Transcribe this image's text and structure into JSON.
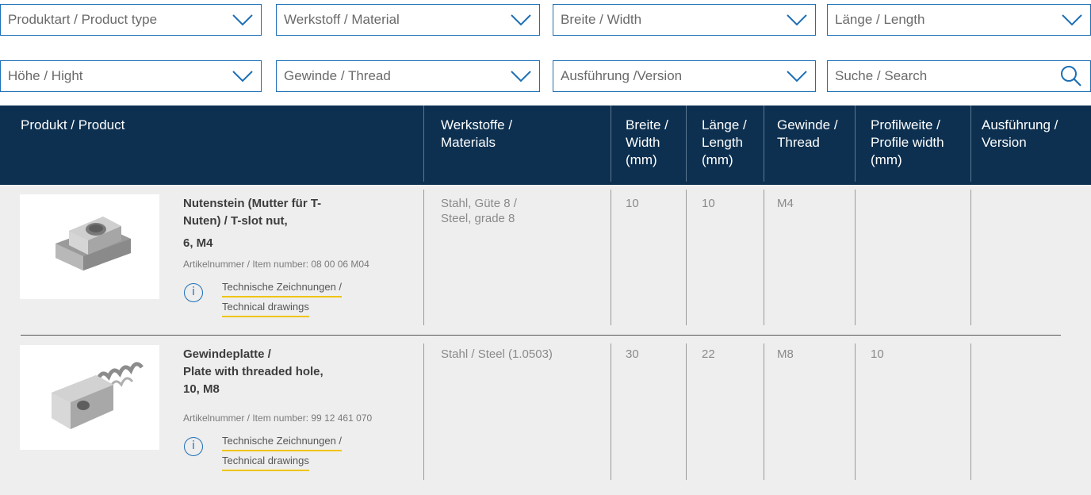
{
  "filters": [
    {
      "label": "Produktart / Product type"
    },
    {
      "label": "Werkstoff / Material"
    },
    {
      "label": "Breite / Width"
    },
    {
      "label": "Länge / Length"
    },
    {
      "label": "Höhe / Hight"
    },
    {
      "label": "Gewinde / Thread"
    },
    {
      "label": "Ausführung /Version"
    }
  ],
  "search": {
    "placeholder": "Suche / Search"
  },
  "columns": [
    {
      "l1": "Produkt / Product",
      "l2": ""
    },
    {
      "l1": "Werkstoffe /",
      "l2": "Materials"
    },
    {
      "l1": "Breite /",
      "l2": "Width",
      "l3": "(mm)"
    },
    {
      "l1": "Länge /",
      "l2": "Length",
      "l3": "(mm)"
    },
    {
      "l1": "Gewinde /",
      "l2": "Thread"
    },
    {
      "l1": "Profilweite /",
      "l2": "Profile width",
      "l3": "(mm)"
    },
    {
      "l1": "Ausführung /",
      "l2": "Version"
    }
  ],
  "rows": [
    {
      "name_l1": "Nutenstein (Mutter für T-",
      "name_l2": "Nuten) / T-slot nut,",
      "name_l3": "6, M4",
      "item_number": "Artikelnummer / Item number: 08 00 06 M04",
      "drawing_l1": "Technische Zeichnungen /",
      "drawing_l2": "Technical drawings",
      "material_l1": "Stahl, Güte 8 /",
      "material_l2": "Steel, grade 8",
      "width": "10",
      "length": "10",
      "thread": "M4",
      "profile_width": "",
      "version": ""
    },
    {
      "name_l1": "Gewindeplatte /",
      "name_l2": "Plate with threaded hole,",
      "name_l3": "10, M8",
      "item_number": "Artikelnummer / Item number: 99 12 461 070",
      "drawing_l1": "Technische Zeichnungen /",
      "drawing_l2": "Technical drawings",
      "material_l1": "Stahl / Steel (1.0503)",
      "material_l2": "",
      "width": "30",
      "length": "22",
      "thread": "M8",
      "profile_width": "10",
      "version": ""
    }
  ],
  "icons": {
    "dropdown": "chevron-down-icon",
    "search": "search-icon",
    "info": "info-icon"
  },
  "colors": {
    "accent": "#1d6fb6",
    "header_bg": "#0d3050",
    "link_underline": "#f0c400",
    "table_bg": "#eeeeee"
  },
  "info_glyph": "i"
}
